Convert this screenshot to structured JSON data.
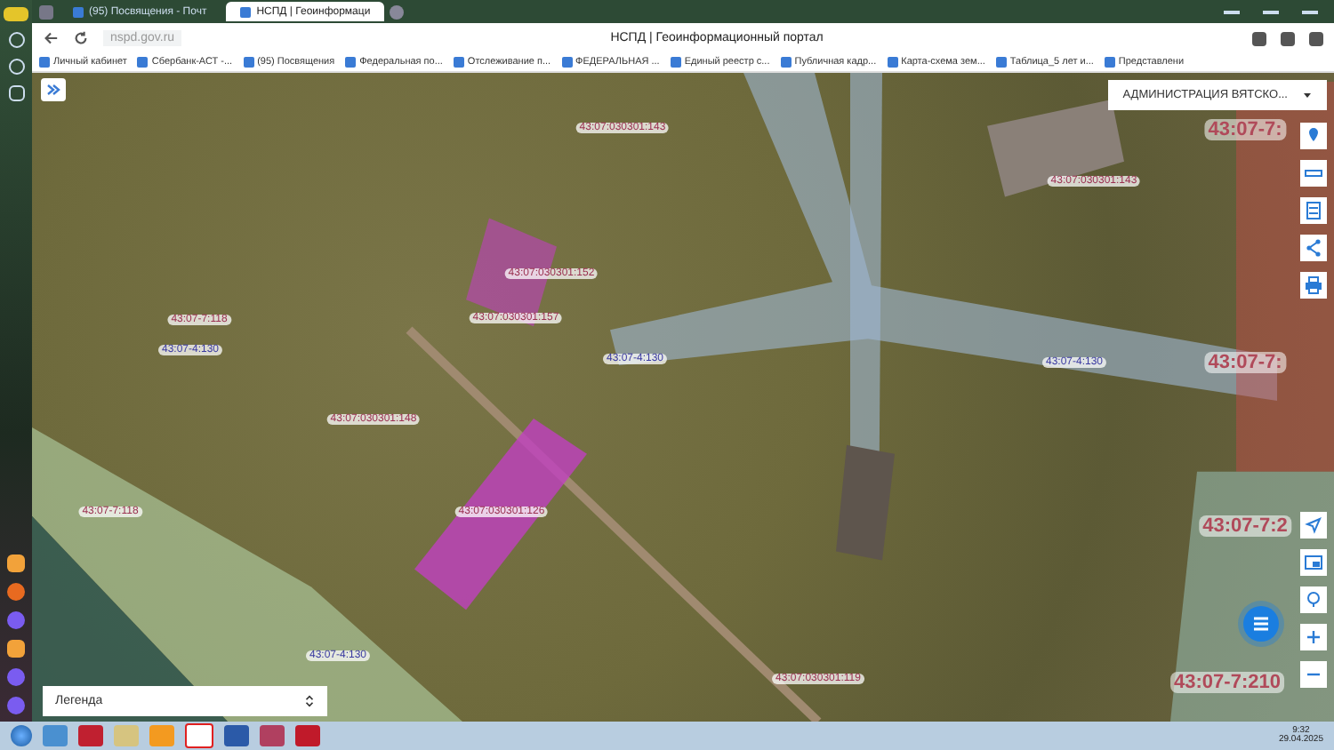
{
  "browser": {
    "tabs": [
      {
        "title": "(95) Посвящения - Почт",
        "selected": false
      },
      {
        "title": "НСПД | Геоинформаци",
        "selected": true
      }
    ],
    "address": "nspd.gov.ru",
    "page_title": "НСПД | Геоинформационный портал",
    "bookmarks": [
      "Личный кабинет",
      "Сбербанк-АСТ -...",
      "(95) Посвящения",
      "Федеральная по...",
      "Отслеживание п...",
      "ФЕДЕРАЛЬНАЯ ...",
      "Единый реестр с...",
      "Публичная кадр...",
      "Карта-схема зем...",
      "Таблица_5 лет и...",
      "Представлени"
    ]
  },
  "map": {
    "region_select": "АДМИНИСТРАЦИЯ ВЯТСКО...",
    "legend": "Легенда",
    "labels": [
      {
        "text": "43:07:030301:143",
        "kind": "parcel"
      },
      {
        "text": "43:07-7:",
        "kind": "quarter"
      },
      {
        "text": "43:07:030301:143",
        "kind": "parcel"
      },
      {
        "text": "43:07:030301:152",
        "kind": "parcel"
      },
      {
        "text": "43:07-7:118",
        "kind": "parcel"
      },
      {
        "text": "43:07:030301:157",
        "kind": "parcel"
      },
      {
        "text": "43:07-4:130",
        "kind": "zone"
      },
      {
        "text": "43:07-4:130",
        "kind": "zone"
      },
      {
        "text": "43:07-4:130",
        "kind": "zone"
      },
      {
        "text": "43:07-7:",
        "kind": "quarter"
      },
      {
        "text": "43:07:030301:148",
        "kind": "parcel"
      },
      {
        "text": "43:07-7:118",
        "kind": "parcel"
      },
      {
        "text": "43:07:030301:126",
        "kind": "parcel"
      },
      {
        "text": "43:07-7:2",
        "kind": "quarter"
      },
      {
        "text": "43:07-4:130",
        "kind": "zone"
      },
      {
        "text": "43:07:030301:119",
        "kind": "parcel"
      },
      {
        "text": "43:07-7:210",
        "kind": "quarter"
      }
    ]
  },
  "taskbar": {
    "time": "9:32",
    "date": "29.04.2025"
  }
}
